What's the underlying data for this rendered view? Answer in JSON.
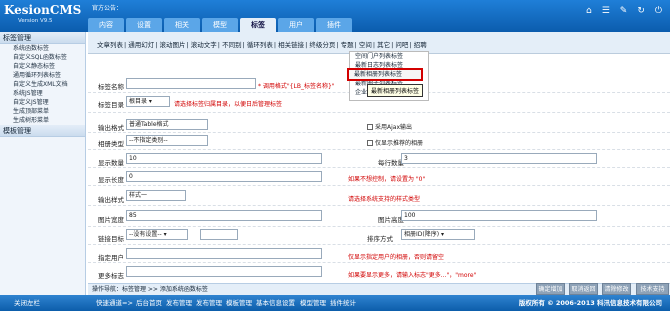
{
  "header": {
    "logo": "KesionCMS",
    "version": "Version V9.5",
    "notice": "官方公告：",
    "tabs": [
      "内容",
      "设置",
      "相关",
      "模型",
      "标签",
      "用户",
      "插件"
    ],
    "active_tab": 4
  },
  "side": {
    "title": "标签管理",
    "items": [
      "系统函数标签",
      "自定义SQL函数标签",
      "自定义静态标签",
      "通用循环列表标签",
      "自定义生成XML文档",
      "系统JS管理",
      "自定义JS管理",
      "生成顶部菜单",
      "生成树形菜单"
    ],
    "title2": "模板管理"
  },
  "toolbar": {
    "items": [
      "文章列表",
      "通用幻灯",
      "滚动图片",
      "滚动文字",
      "不同别",
      "循环列表",
      "相关链接",
      "终级分页",
      "专题",
      "空间",
      "其它",
      "问吧",
      "招聘"
    ]
  },
  "dropdown": {
    "items": [
      "空间门户列表标签",
      "最新日志列表标签",
      "最新相册列表标签",
      "最新圈子列表标签",
      "企业新闻列表标签"
    ],
    "tooltip": "最新相册列表标签"
  },
  "form": {
    "name_label": "标签名称",
    "name_value": "",
    "name_hint": "* 调用格式\"{LB_标签名称}\"",
    "dir_label": "标签目录",
    "dir_value": "根目录",
    "dir_hint": "请选择标签归属目录，以便日后管理标签",
    "format_label": "输出格式",
    "format_value": "普通Table格式",
    "ajax_label": "采用Ajax输出",
    "attr_label": "相册类型",
    "attr_value": "--不指定类别--",
    "rec_label": "仅显示推荐的相册",
    "count_label": "显示数量",
    "count_value": "10",
    "cols_label": "每行数量",
    "cols_value": "3",
    "len_label": "显示长度",
    "len_value": "0",
    "len_hint": "如果不想控制，请设置为 \"0\"",
    "style_label": "输出样式",
    "style_value": "样式一",
    "style_hint": "请选择系统支持的样式类型",
    "w_label": "图片宽度",
    "w_value": "85",
    "h_label": "图片高度",
    "h_value": "100",
    "target_label": "链接目标",
    "target_value": "--没有设置--",
    "order_label": "排序方式",
    "order_value": "相册ID(降序)",
    "user_label": "指定用户",
    "user_value": "",
    "user_hint": "仅显示指定用户的相册，否则请留空",
    "more_label": "更多标志",
    "more_value": "",
    "more_hint": "如果要显示更多，请输入标志\"更多...\"，\"more\""
  },
  "status": {
    "text": "操作导航：标签管理 >> 添加系统函数标签"
  },
  "buttons": [
    "确定增加",
    "取消返回",
    "清除修改",
    "技术支持"
  ],
  "footer": {
    "left": "关闭左栏",
    "quick_label": "快速通道=>",
    "links": [
      "后台首页",
      "发布管理",
      "发布管理",
      "模板管理",
      "基本信息设置",
      "模型管理",
      "插件统计"
    ],
    "copyright": "版权所有 © 2006-2013 科汛信息技术有限公司"
  }
}
